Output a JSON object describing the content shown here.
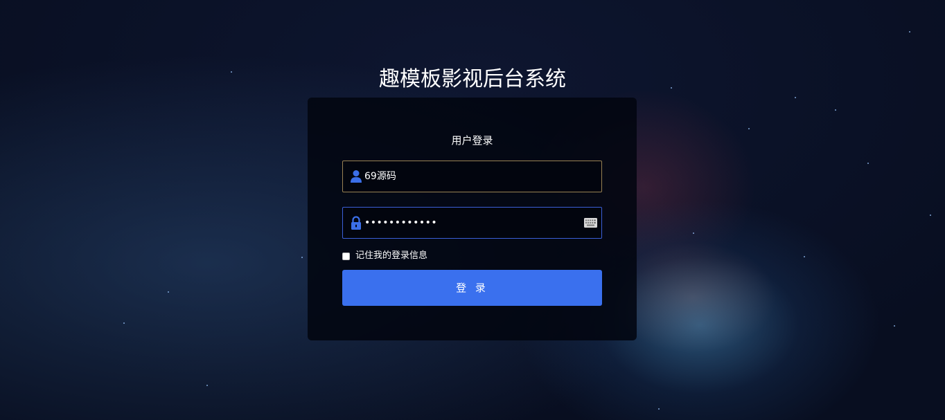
{
  "page": {
    "title": "趣模板影视后台系统"
  },
  "login": {
    "heading": "用户登录",
    "username": {
      "value": "69源码",
      "icon": "user-icon"
    },
    "password": {
      "value": "••••••••••••",
      "icon": "lock-icon",
      "keyboard_icon": "keyboard-icon"
    },
    "remember": {
      "label": "记住我的登录信息",
      "checked": false
    },
    "submit_label": "登 录"
  },
  "colors": {
    "accent": "#3a70ee",
    "username_border": "#9a8253",
    "password_border": "#3b5fd8",
    "icon": "#3b6fe8"
  }
}
